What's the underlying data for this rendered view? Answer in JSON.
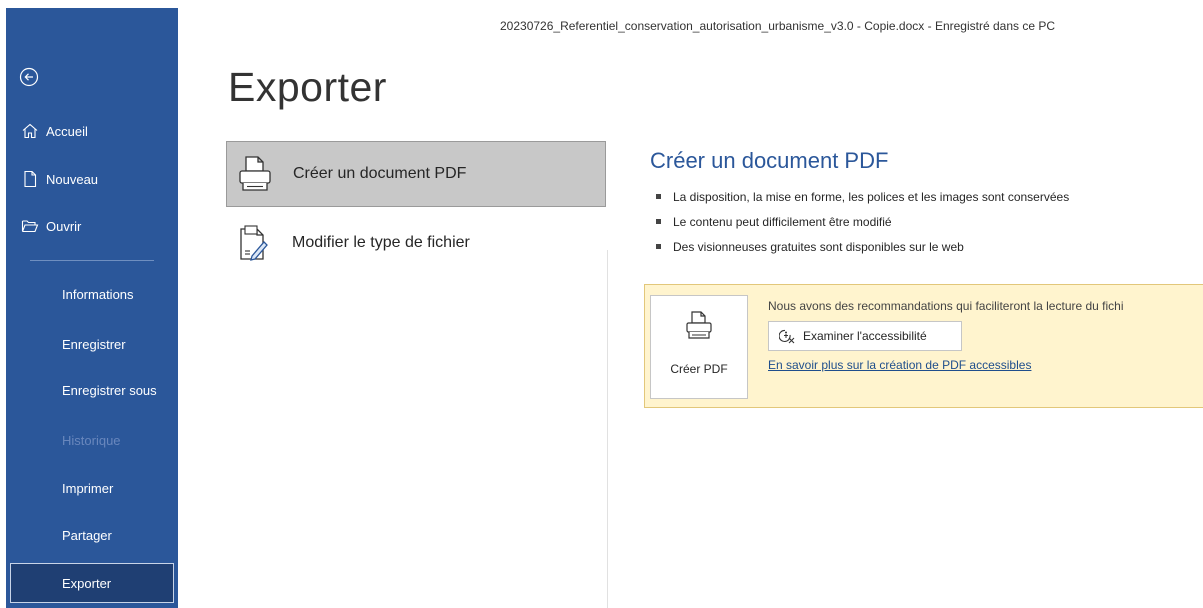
{
  "window": {
    "document_title": "20230726_Referentiel_conservation_autorisation_urbanisme_v3.0 - Copie.docx  -  Enregistré dans ce PC"
  },
  "sidebar": {
    "back_icon": "back-arrow-icon",
    "top_items": [
      {
        "label": "Accueil",
        "icon": "home-icon"
      },
      {
        "label": "Nouveau",
        "icon": "new-document-icon"
      },
      {
        "label": "Ouvrir",
        "icon": "folder-open-icon"
      }
    ],
    "items": [
      {
        "label": "Informations"
      },
      {
        "label": "Enregistrer"
      },
      {
        "label": "Enregistrer sous"
      },
      {
        "label": "Historique",
        "disabled": true
      },
      {
        "label": "Imprimer"
      },
      {
        "label": "Partager"
      },
      {
        "label": "Exporter",
        "selected": true
      }
    ],
    "colors": {
      "background": "#2b579a",
      "selected": "#1f3f73"
    }
  },
  "main": {
    "title": "Exporter",
    "options": [
      {
        "label": "Créer un document PDF",
        "icon": "pdf-document-icon",
        "selected": true
      },
      {
        "label": "Modifier le type de fichier",
        "icon": "change-file-type-icon",
        "selected": false
      }
    ]
  },
  "details": {
    "title": "Créer un document PDF",
    "bullets": [
      "La disposition, la mise en forme, les polices et les images sont conservées",
      "Le contenu peut difficilement être modifié",
      "Des visionneuses gratuites sont disponibles sur le web"
    ],
    "create_button": {
      "label": "Créer PDF",
      "icon": "pdf-document-icon"
    },
    "notice": {
      "text": "Nous avons des recommandations qui faciliteront la lecture du fichi",
      "accessibility_button": "Examiner l'accessibilité",
      "accessibility_icon": "accessibility-check-icon",
      "link": "En savoir plus sur la création de PDF accessibles"
    },
    "colors": {
      "title": "#2b579a",
      "notice_background": "#fff4ce"
    }
  }
}
